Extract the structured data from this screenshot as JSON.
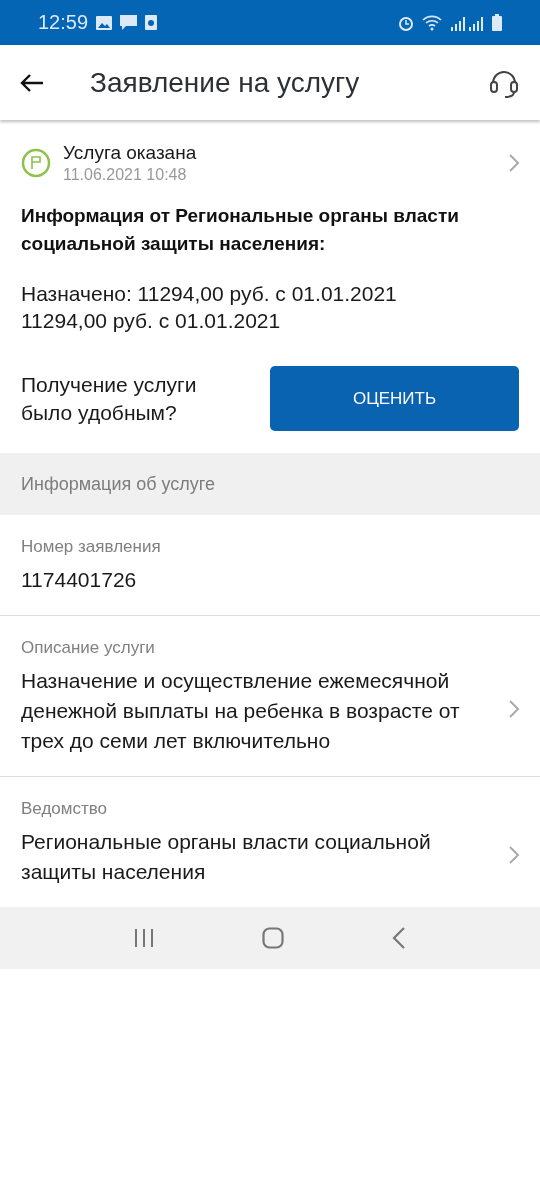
{
  "status_bar": {
    "time": "12:59"
  },
  "header": {
    "title": "Заявление на услугу"
  },
  "status": {
    "label": "Услуга оказана",
    "date": "11.06.2021 10:48"
  },
  "info": {
    "title": "Информация от Региональные органы власти социальной защиты населения:",
    "text": "Назначено: 11294,00 руб. с 01.01.2021\n11294,00 руб. с 01.01.2021"
  },
  "rating": {
    "question": "Получение услуги было удобным?",
    "button": "ОЦЕНИТЬ"
  },
  "section": {
    "title": "Информация об услуге"
  },
  "fields": [
    {
      "label": "Номер заявления",
      "value": "1174401726",
      "kind": "plain"
    },
    {
      "label": "Описание услуги",
      "value": "Назначение и осуществление ежемесячной денежной выплаты на ребенка в возрасте от трех до семи лет включительно",
      "kind": "link"
    },
    {
      "label": "Ведомство",
      "value": "Региональные органы власти социальной защиты населения",
      "kind": "link"
    }
  ]
}
